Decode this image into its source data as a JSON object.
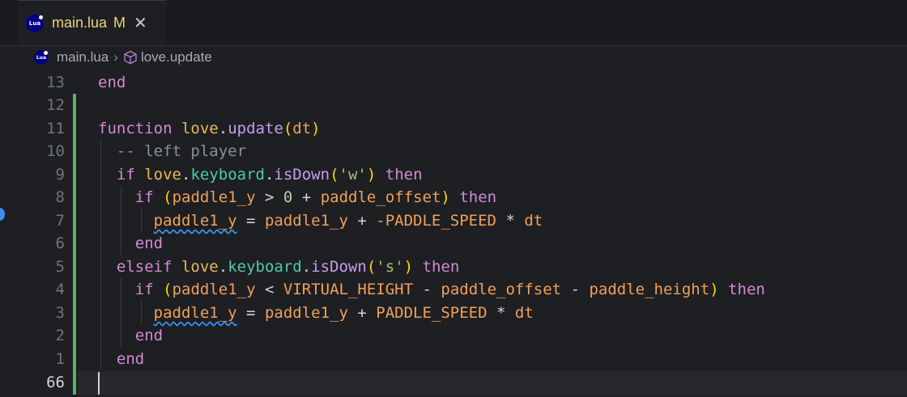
{
  "tab": {
    "filename": "main.lua",
    "badge": "M",
    "close_icon": "close-icon"
  },
  "breadcrumb": {
    "file": "main.lua",
    "separator": ">",
    "symbol": "love.update"
  },
  "editor": {
    "lines": [
      {
        "number": "13"
      },
      {
        "number": "12"
      },
      {
        "number": "11"
      },
      {
        "number": "10"
      },
      {
        "number": "9"
      },
      {
        "number": "8"
      },
      {
        "number": "7"
      },
      {
        "number": "6"
      },
      {
        "number": "5"
      },
      {
        "number": "4"
      },
      {
        "number": "3"
      },
      {
        "number": "2"
      },
      {
        "number": "1"
      },
      {
        "number": "66"
      }
    ],
    "tokens": {
      "end": "end",
      "function": "function",
      "love": "love",
      "dot": ".",
      "update": "update",
      "lparen": "(",
      "rparen": ")",
      "dt": "dt",
      "comment": "-- left player",
      "if": "if",
      "keyboard": "keyboard",
      "isDown": "isDown",
      "w_str": "'w'",
      "then": "then",
      "paddle1_y": "paddle1_y",
      "gt": ">",
      "zero": "0",
      "plus": "+",
      "paddle_offset": "paddle_offset",
      "assign": "=",
      "neg_speed": "-PADDLE_SPEED",
      "mul": "*",
      "elseif": "elseif",
      "s_str": "'s'",
      "lt": "<",
      "virtual_height": "VIRTUAL_HEIGHT",
      "minus": "-",
      "paddle_height": "paddle_height",
      "paddle_speed": "PADDLE_SPEED"
    }
  },
  "colors": {
    "background": "#1e1f22",
    "git_added_bar": "#5faf6a",
    "modified_tab_text": "#e8d47a"
  }
}
